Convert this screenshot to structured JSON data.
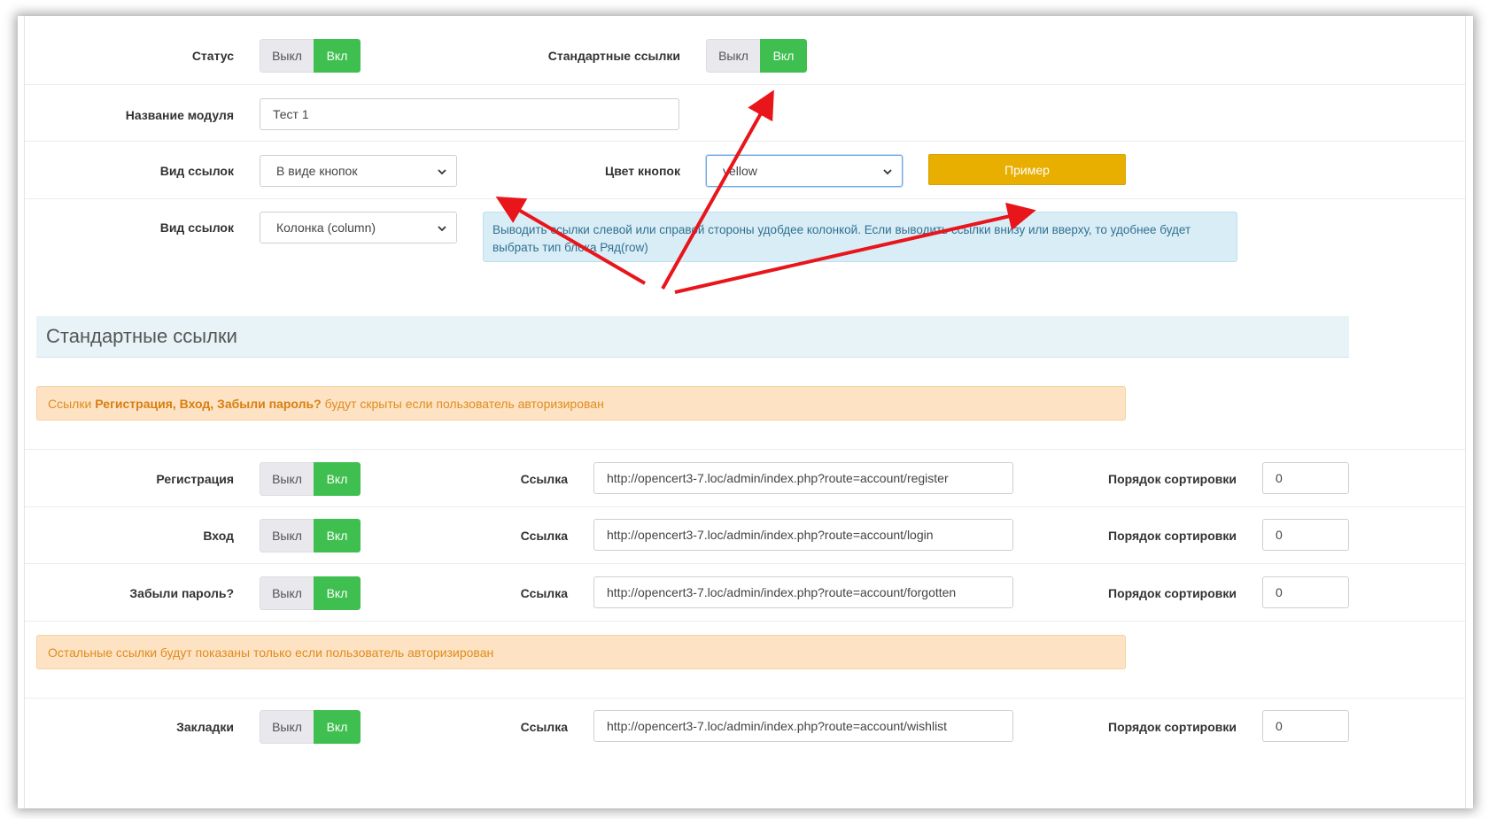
{
  "top": {
    "status_label": "Статус",
    "std_links_label": "Стандартные ссылки",
    "off_label": "Выкл",
    "on_label": "Вкл",
    "module_name_label": "Название модуля",
    "module_name_value": "Тест 1",
    "links_view_label": "Вид ссылок",
    "links_view_value": "В виде кнопок",
    "button_color_label": "Цвет кнопок",
    "button_color_value": "yellow",
    "sample_button": "Пример",
    "links_layout_label": "Вид ссылок",
    "links_layout_value": "Колонка (column)",
    "info_text": "Выводить ссылки слевой или справой стороны удобдее колонкой. Если выводить ссылки внизу или вверху, то удобнее будет выбрать тип блока Ряд(row)"
  },
  "section": {
    "title": "Стандартные ссылки",
    "warn1_pre": "Ссылки",
    "warn1_bold": "Регистрация, Вход, Забыли пароль?",
    "warn1_post": "будут скрыты если пользователь авторизирован",
    "warn2": "Остальные ссылки будут показаны только если пользователь авторизирован",
    "link_label": "Ссылка",
    "sort_label": "Порядок сортировки",
    "rows": [
      {
        "name": "Регистрация",
        "url": "http://opencert3-7.loc/admin/index.php?route=account/register",
        "sort": "0"
      },
      {
        "name": "Вход",
        "url": "http://opencert3-7.loc/admin/index.php?route=account/login",
        "sort": "0"
      },
      {
        "name": "Забыли пароль?",
        "url": "http://opencert3-7.loc/admin/index.php?route=account/forgotten",
        "sort": "0"
      },
      {
        "name": "Закладки",
        "url": "http://opencert3-7.loc/admin/index.php?route=account/wishlist",
        "sort": "0"
      }
    ]
  },
  "colors": {
    "toggle_on": "#3fbf4f",
    "toggle_off": "#e8e8ed",
    "sample_button": "#e8ae00",
    "annotation_arrow": "#e8151b"
  }
}
